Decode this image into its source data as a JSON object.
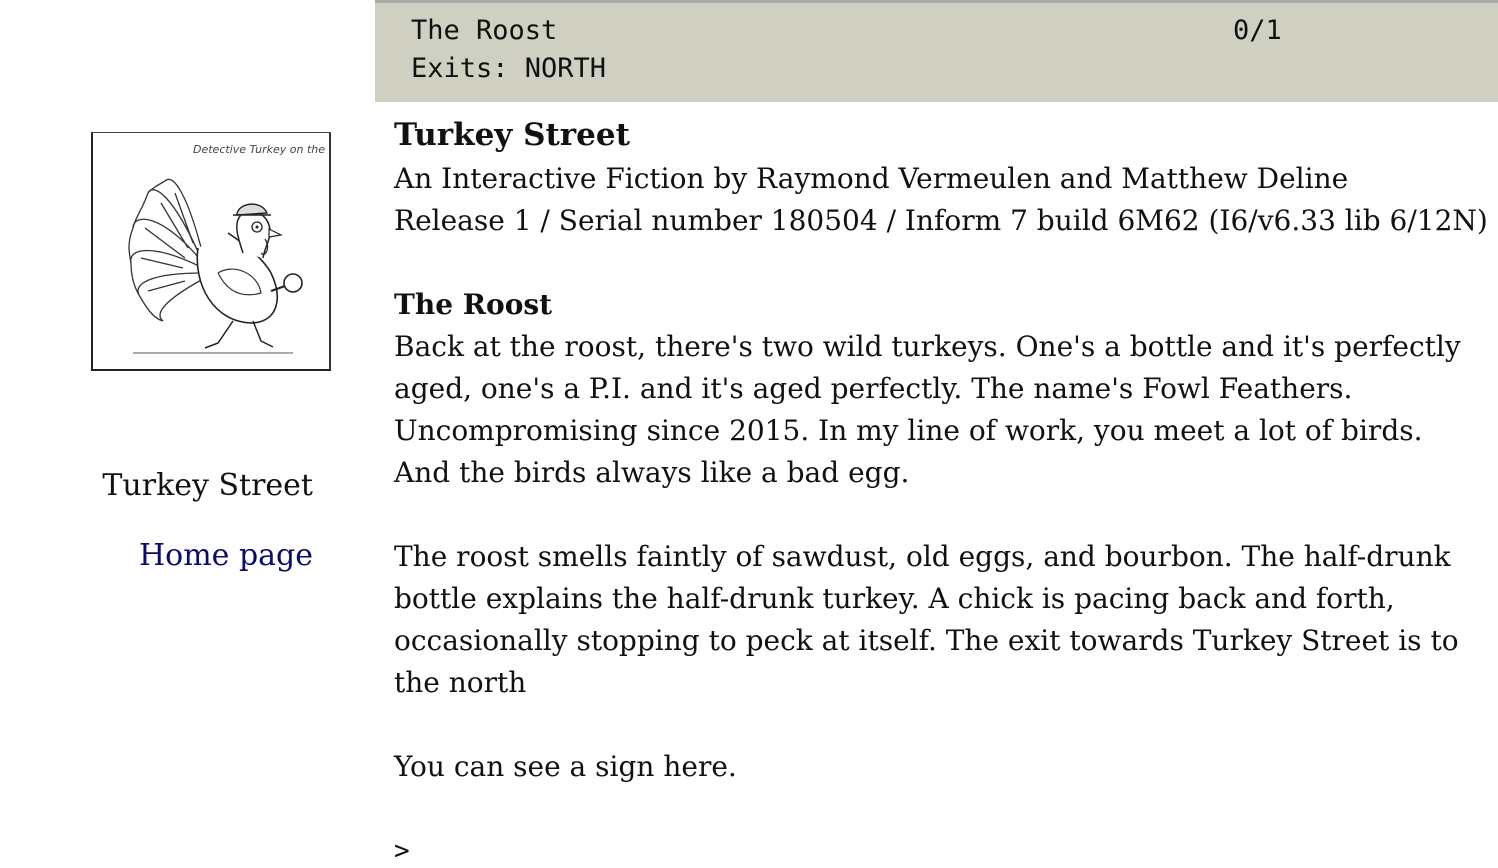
{
  "status": {
    "room": "The Roost",
    "exits": "Exits: NORTH",
    "score": "0/1"
  },
  "sidebar": {
    "cover_caption": "Detective Turkey on the case",
    "title": "Turkey Street",
    "home_link": "Home page"
  },
  "main": {
    "game_title": "Turkey Street",
    "byline": "An Interactive Fiction by Raymond Vermeulen and Matthew Deline",
    "release": "Release 1 / Serial number 180504 / Inform 7 build 6M62 (I6/v6.33 lib 6/12N)",
    "room_heading": "The Roost",
    "room_text_1": "Back at the roost, there's two wild turkeys. One's a bottle and it's perfectly aged, one's a P.I. and it's aged perfectly. The name's Fowl Feathers. Uncompromising since 2015. In my line of work, you meet a lot of birds. And the birds always like a bad egg.",
    "room_text_2": "The roost smells faintly of sawdust, old eggs, and bourbon. The half-drunk bottle explains the half-drunk turkey. A chick is pacing back and forth, occasionally stopping to peck at itself. The exit towards Turkey Street is to the north",
    "room_text_3": "You can see a sign here.",
    "prompt": ">",
    "command_value": ""
  }
}
